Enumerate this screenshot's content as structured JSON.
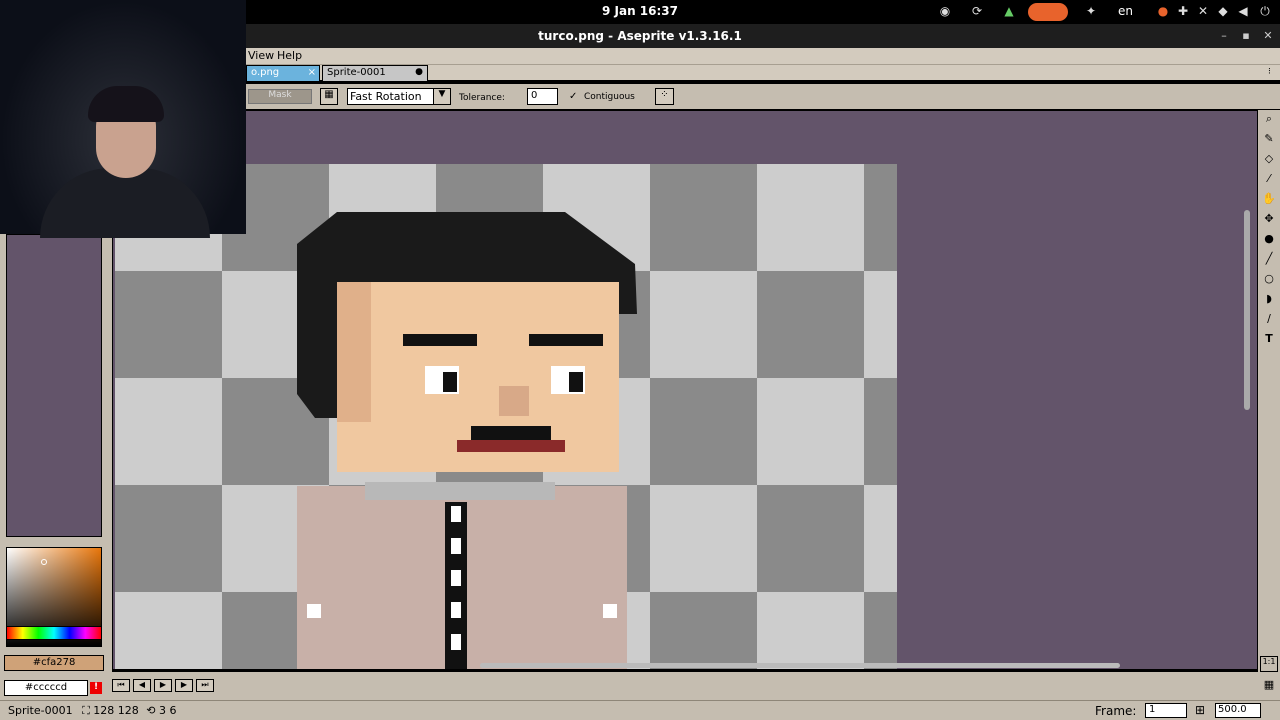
{
  "system": {
    "clock": "9 Jan  16:37",
    "language": "en"
  },
  "window": {
    "title": "turco.png - Aseprite v1.3.16.1"
  },
  "menu": {
    "items": [
      "View",
      "Help"
    ]
  },
  "tabs": [
    {
      "label": "o.png",
      "close": "×"
    },
    {
      "label": "Sprite-0001",
      "modified": "●"
    }
  ],
  "toolbar": {
    "mask_label": "Mask",
    "rotation_value": "Fast Rotation",
    "tolerance_label": "Tolerance:",
    "tolerance_value": "0",
    "contiguous_label": "Contiguous",
    "contiguous_checked": true
  },
  "colors": {
    "foreground_hex": "#cfa278",
    "background_hex": "#cccccd",
    "editor_bg": "#63546a",
    "panel_bg": "#c5bdb0"
  },
  "statusbar": {
    "sprite_name": "Sprite-0001",
    "size": "128 128",
    "frames": "3 6",
    "frame_label": "Frame:",
    "frame_value": "1",
    "zoom": "500.0"
  },
  "icons": {
    "tools": [
      "zoom-icon",
      "pencil-icon",
      "eraser-icon",
      "eyedropper-icon",
      "hand-icon",
      "move-icon",
      "bucket-icon",
      "line-icon",
      "ellipse-icon",
      "contour-icon",
      "blur-icon",
      "text-icon"
    ]
  }
}
